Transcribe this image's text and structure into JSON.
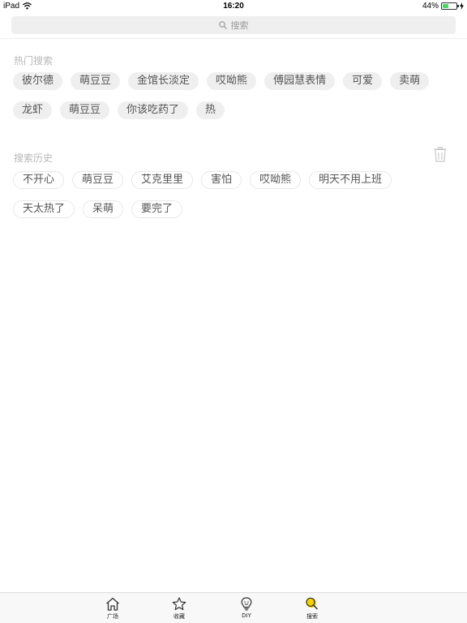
{
  "status": {
    "device": "iPad",
    "time": "16:20",
    "battery": "44%",
    "battery_level": 0.44
  },
  "search": {
    "placeholder": "搜索"
  },
  "hot": {
    "title": "热门搜索",
    "tags": [
      "彼尔德",
      "萌豆豆",
      "金馆长淡定",
      "哎呦熊",
      "傅园慧表情",
      "可爱",
      "卖萌",
      "龙虾",
      "萌豆豆",
      "你该吃药了",
      "热"
    ]
  },
  "history": {
    "title": "搜索历史",
    "tags": [
      "不开心",
      "萌豆豆",
      "艾克里里",
      "害怕",
      "哎呦熊",
      "明天不用上班",
      "天太热了",
      "呆萌",
      "要完了"
    ]
  },
  "tabbar": {
    "items": [
      {
        "label": "广场",
        "icon": "home-icon"
      },
      {
        "label": "收藏",
        "icon": "star-icon"
      },
      {
        "label": "DIY",
        "icon": "lightbulb-face-icon"
      },
      {
        "label": "搜索",
        "icon": "search-icon"
      }
    ],
    "active_color": "#f5d300"
  }
}
